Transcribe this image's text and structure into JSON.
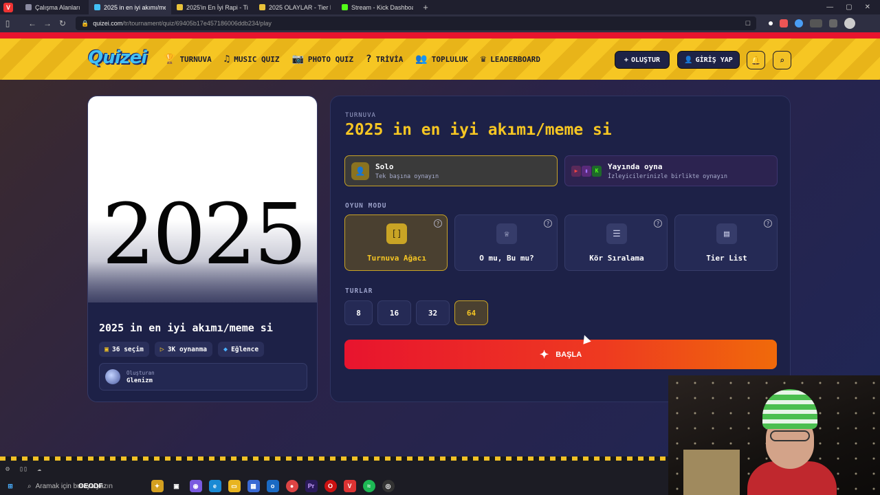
{
  "browser": {
    "tabs": [
      {
        "label": "Çalışma Alanları",
        "color": "#8a8aa0",
        "active": false
      },
      {
        "label": "2025 in en iyi akımı/meme",
        "color": "#42c0f5",
        "active": true
      },
      {
        "label": "2025'in En İyi Rapi - Tier Li",
        "color": "#e8c23a",
        "active": false
      },
      {
        "label": "2025 OLAYLAR - Tier List | ",
        "color": "#e8c23a",
        "active": false
      },
      {
        "label": "Stream - Kick Dashboard",
        "color": "#53fc18",
        "active": false
      }
    ],
    "new_tab": "+",
    "url_host": "quizei.com",
    "url_path": "/tr/tournament/quiz/69405b17e457186006ddb234/play"
  },
  "header": {
    "logo": "Quizei",
    "nav": [
      {
        "icon": "trophy-icon",
        "glyph": "🏆",
        "label": "TURNUVA"
      },
      {
        "icon": "music-icon",
        "glyph": "♫",
        "label": "MUSIC QUIZ"
      },
      {
        "icon": "camera-icon",
        "glyph": "📷",
        "label": "PHOTO QUIZ"
      },
      {
        "icon": "question-icon",
        "glyph": "?",
        "label": "TRİVİA"
      },
      {
        "icon": "users-icon",
        "glyph": "👥",
        "label": "TOPLULUK"
      },
      {
        "icon": "award-icon",
        "glyph": "♛",
        "label": "LEADERBOARD"
      }
    ],
    "create_label": "OLUŞTUR",
    "login_label": "GİRİŞ YAP"
  },
  "quiz_card": {
    "cover_text": "2025",
    "title": "2025 in en iyi akımı/meme si",
    "chips": [
      {
        "icon": "image-icon",
        "glyph": "▣",
        "label": "36 seçim"
      },
      {
        "icon": "play-icon",
        "glyph": "▷",
        "label": "3K oynanma"
      },
      {
        "icon": "category-icon",
        "glyph": "◆",
        "label": "Eğlence"
      }
    ],
    "creator_label": "Oluşturan",
    "creator_name": "Glenizm"
  },
  "panel": {
    "kicker": "TURNUVA",
    "title": "2025 in en iyi akımı/meme si",
    "play_options": [
      {
        "name": "Solo",
        "sub": "Tek başına oynayın",
        "selected": true
      },
      {
        "name": "Yayında oyna",
        "sub": "İzleyicilerinizle birlikte oynayın",
        "selected": false
      }
    ],
    "mode_label": "OYUN MODU",
    "modes": [
      {
        "label": "Turnuva Ağacı",
        "glyph": "[]",
        "icon": "bracket-icon",
        "selected": true
      },
      {
        "label": "O mu, Bu mu?",
        "glyph": "♕",
        "icon": "crown-icon",
        "selected": false
      },
      {
        "label": "Kör Sıralama",
        "glyph": "☰",
        "icon": "ranking-icon",
        "selected": false
      },
      {
        "label": "Tier List",
        "glyph": "▤",
        "icon": "tierlist-icon",
        "selected": false
      }
    ],
    "rounds_label": "TURLAR",
    "rounds": [
      "8",
      "16",
      "32",
      "64"
    ],
    "selected_round": "64",
    "start_label": "BAŞLA"
  },
  "taskbar": {
    "search_placeholder": "Aramak için buraya yazın",
    "streamer_text": "OEODF"
  }
}
